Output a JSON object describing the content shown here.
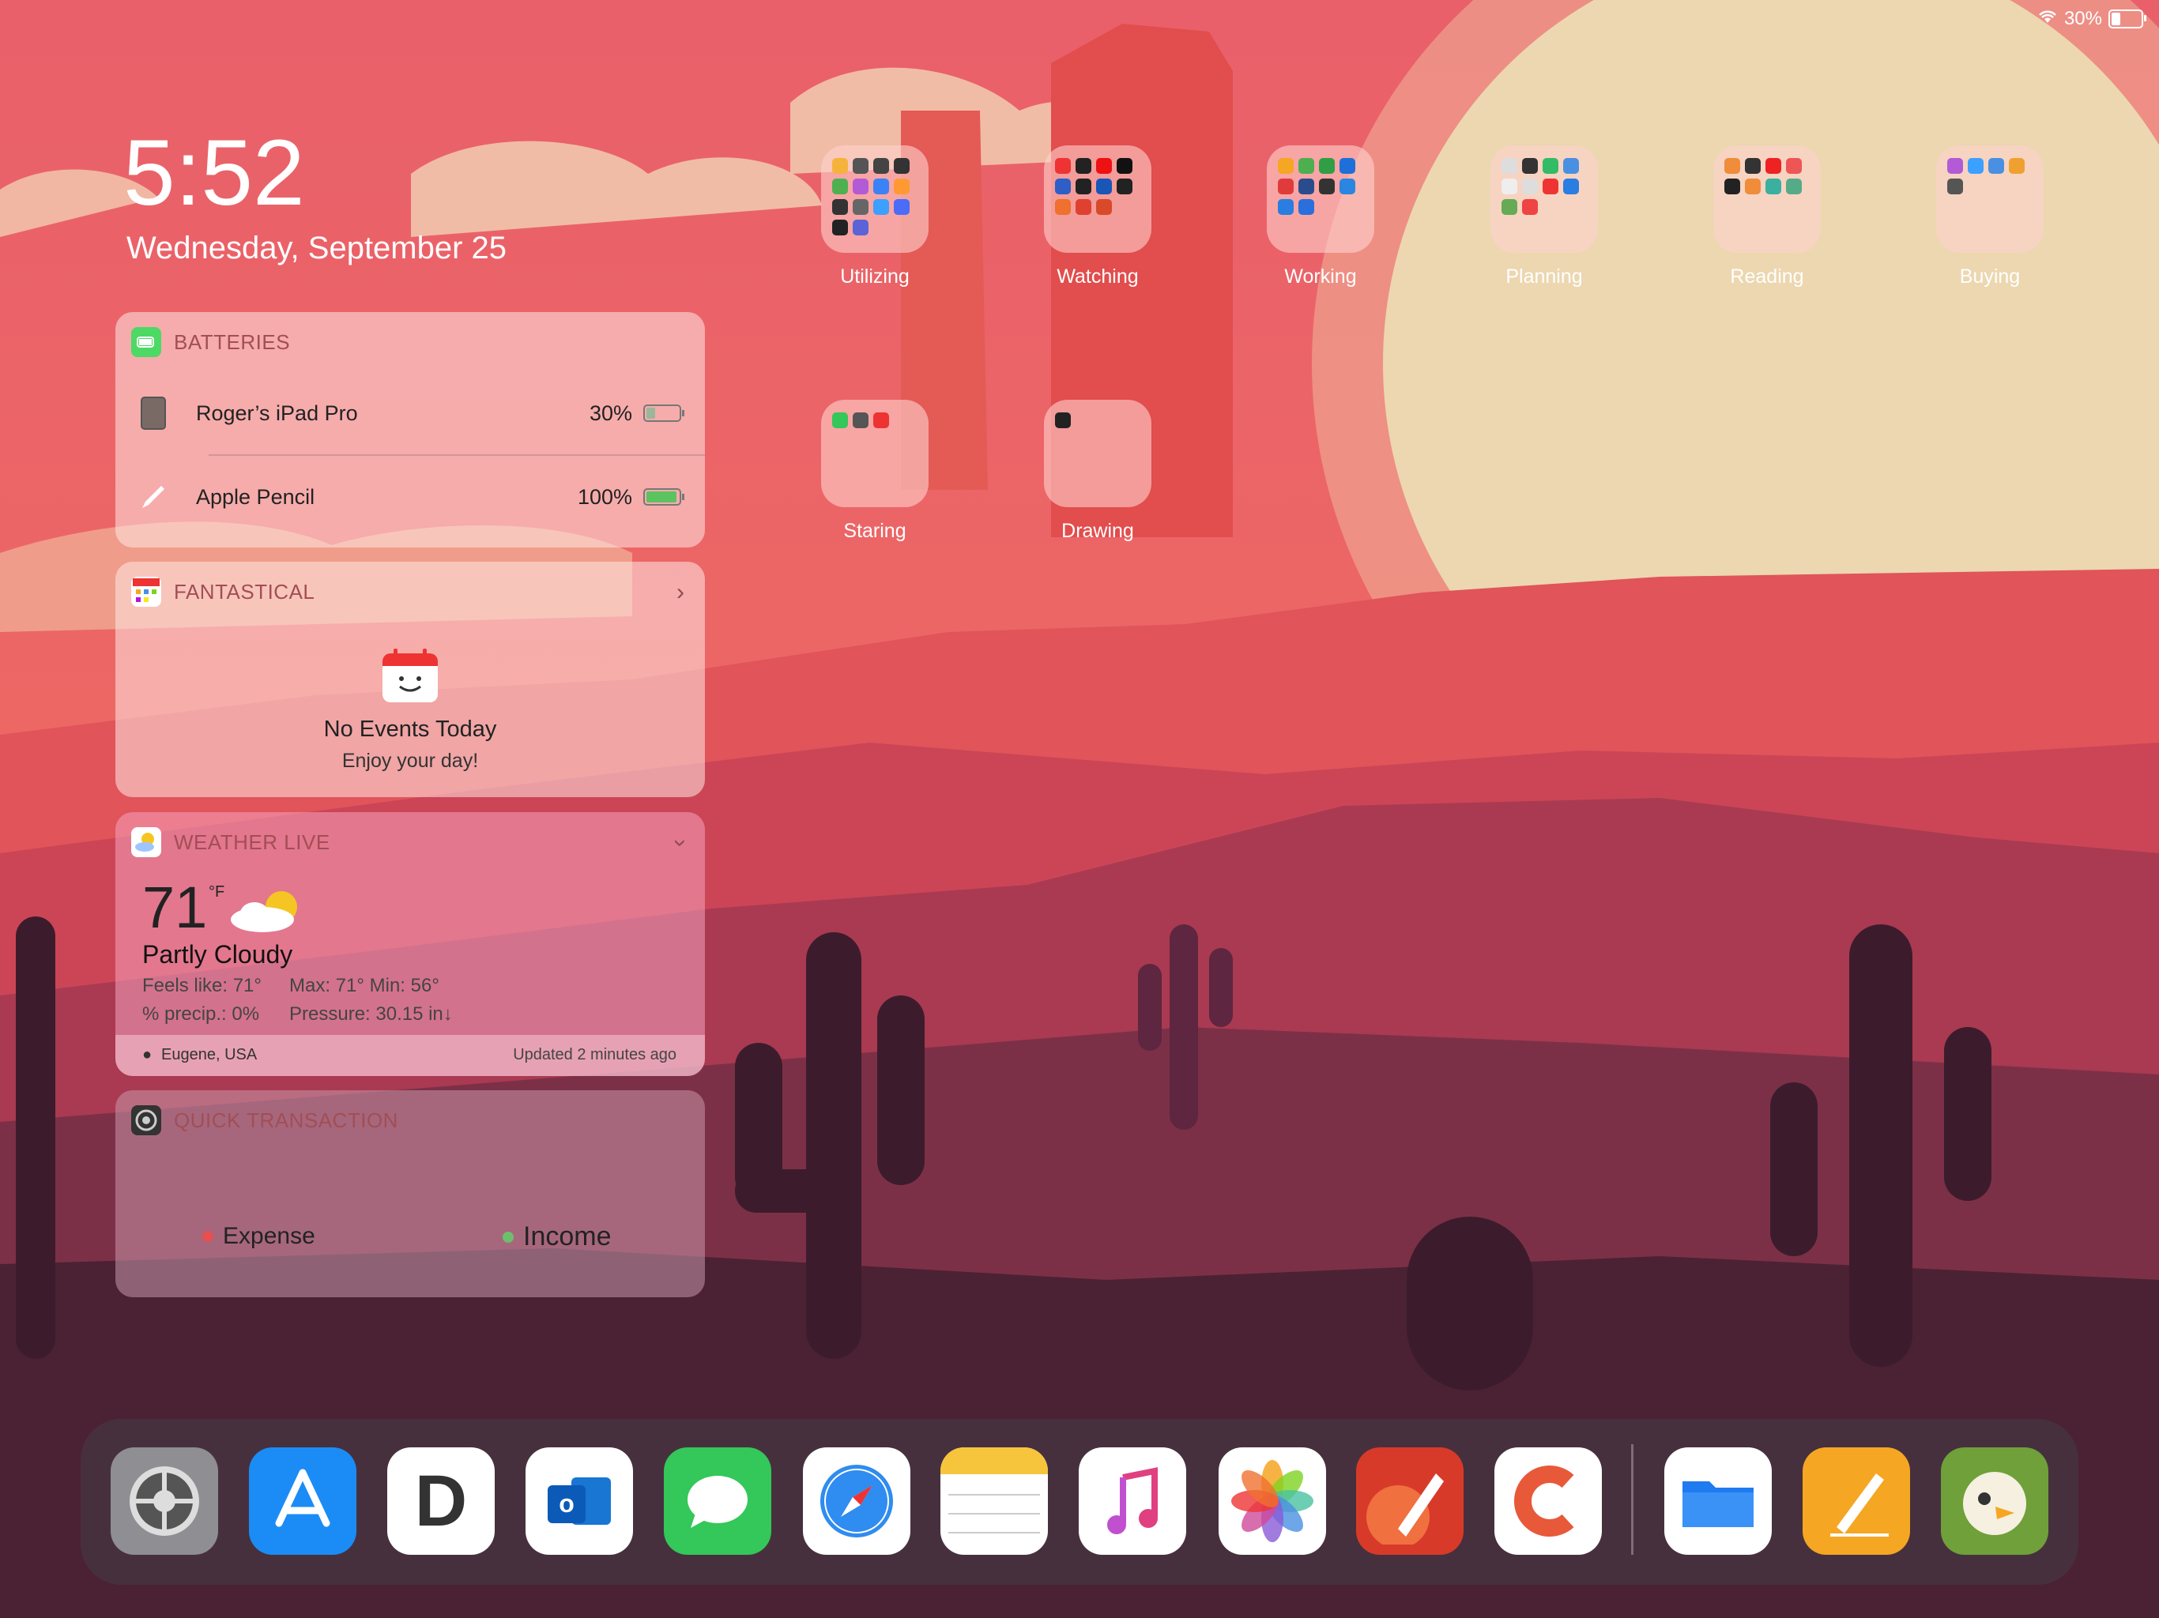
{
  "status_bar": {
    "battery_percent": "30%",
    "battery_level": 0.3
  },
  "lock": {
    "time": "5:52",
    "date": "Wednesday, September 25"
  },
  "widgets": {
    "batteries": {
      "title": "BATTERIES",
      "devices": [
        {
          "name": "Roger’s iPad Pro",
          "percent": "30%",
          "level": 0.3,
          "icon": "ipad-icon"
        },
        {
          "name": "Apple Pencil",
          "percent": "100%",
          "level": 1.0,
          "icon": "pencil-icon"
        }
      ]
    },
    "fantastical": {
      "title": "FANTASTICAL",
      "no_events": "No Events Today",
      "subtitle": "Enjoy your day!"
    },
    "weather": {
      "title": "WEATHER LIVE",
      "temp": "71",
      "unit": "°F",
      "condition": "Partly Cloudy",
      "feels_like": "Feels like: 71°",
      "maxmin": "Max: 71° Min: 56°",
      "precip": "% precip.: 0%",
      "pressure": "Pressure: 30.15 in↓",
      "location": "Eugene, USA",
      "updated": "Updated 2 minutes ago"
    },
    "quick_transaction": {
      "title": "QUICK TRANSACTION",
      "expense": "Expense",
      "income": "Income"
    }
  },
  "folders": [
    {
      "label": "Utilizing",
      "colors": [
        "#f6b33b",
        "#555",
        "#444",
        "#333",
        "#4fb04f",
        "#b35ad6",
        "#3b82f6",
        "#ff9a33",
        "#333",
        "#666",
        "#3ba0ff",
        "#4a6cf7",
        "#222",
        "#5b63d6"
      ]
    },
    {
      "label": "Watching",
      "colors": [
        "#e33",
        "#222",
        "#e11",
        "#111",
        "#2d5fc7",
        "#222",
        "#1a55b8",
        "#222",
        "#f07030",
        "#e04030",
        "#d84a2a"
      ]
    },
    {
      "label": "Working",
      "colors": [
        "#f5a623",
        "#4caf50",
        "#2f9e44",
        "#1e6fd9",
        "#e03b3b",
        "#2b4c8c",
        "#333",
        "#2a86e0",
        "#2a7de1",
        "#2a6fdb"
      ]
    },
    {
      "label": "Planning",
      "colors": [
        "#ddd",
        "#333",
        "#3b6",
        "#4a90e2",
        "#eee",
        "#ddd",
        "#e33",
        "#2a7de1",
        "#6a5",
        "#e44"
      ]
    },
    {
      "label": "Reading",
      "colors": [
        "#f08c3a",
        "#333",
        "#e22",
        "#e55",
        "#222",
        "#f08c3a",
        "#3ab0a0",
        "#5a8"
      ]
    },
    {
      "label": "Buying",
      "colors": [
        "#b35ad6",
        "#3ba0ff",
        "#4a90e2",
        "#f0a030",
        "#555"
      ]
    },
    {
      "label": "Staring",
      "colors": [
        "#34c759",
        "#555",
        "#e33"
      ]
    },
    {
      "label": "Drawing",
      "colors": [
        "#222"
      ]
    }
  ],
  "dock": [
    {
      "name": "settings-app-icon",
      "bg": "#8e8e93"
    },
    {
      "name": "app-store-app-icon",
      "bg": "#1b8cf5"
    },
    {
      "name": "day-one-app-icon",
      "bg": "#ffffff"
    },
    {
      "name": "outlook-app-icon",
      "bg": "#ffffff"
    },
    {
      "name": "messages-app-icon",
      "bg": "#34c759"
    },
    {
      "name": "safari-app-icon",
      "bg": "#ffffff"
    },
    {
      "name": "notes-app-icon",
      "bg": "#ffffff"
    },
    {
      "name": "music-app-icon",
      "bg": "#ffffff"
    },
    {
      "name": "photos-app-icon",
      "bg": "#ffffff"
    },
    {
      "name": "vectornator-app-icon",
      "bg": "#d83a2a"
    },
    {
      "name": "castro-app-icon",
      "bg": "#ffffff"
    },
    {
      "name": "files-app-icon",
      "bg": "#ffffff"
    },
    {
      "name": "pages-app-icon",
      "bg": "#f5a623"
    },
    {
      "name": "tweetbot-app-icon",
      "bg": "#6fa03a"
    }
  ]
}
